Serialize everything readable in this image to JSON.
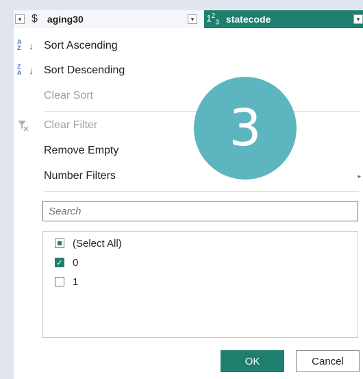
{
  "header": {
    "col1_type_icon": "$",
    "col1_name": "aging30",
    "col2_type_icon": "123",
    "col2_name": "statecode"
  },
  "menu": {
    "sort_ascending": "Sort Ascending",
    "sort_descending": "Sort Descending",
    "clear_sort": "Clear Sort",
    "clear_filter": "Clear Filter",
    "remove_empty": "Remove Empty",
    "number_filters": "Number Filters"
  },
  "search": {
    "placeholder": "Search"
  },
  "values": [
    {
      "label": "(Select All)",
      "state": "partial"
    },
    {
      "label": "0",
      "state": "checked"
    },
    {
      "label": "1",
      "state": "unchecked"
    }
  ],
  "buttons": {
    "ok": "OK",
    "cancel": "Cancel"
  },
  "badge": {
    "text": "3",
    "color": "#5db6bf"
  },
  "colors": {
    "accent": "#1e7f6e"
  }
}
